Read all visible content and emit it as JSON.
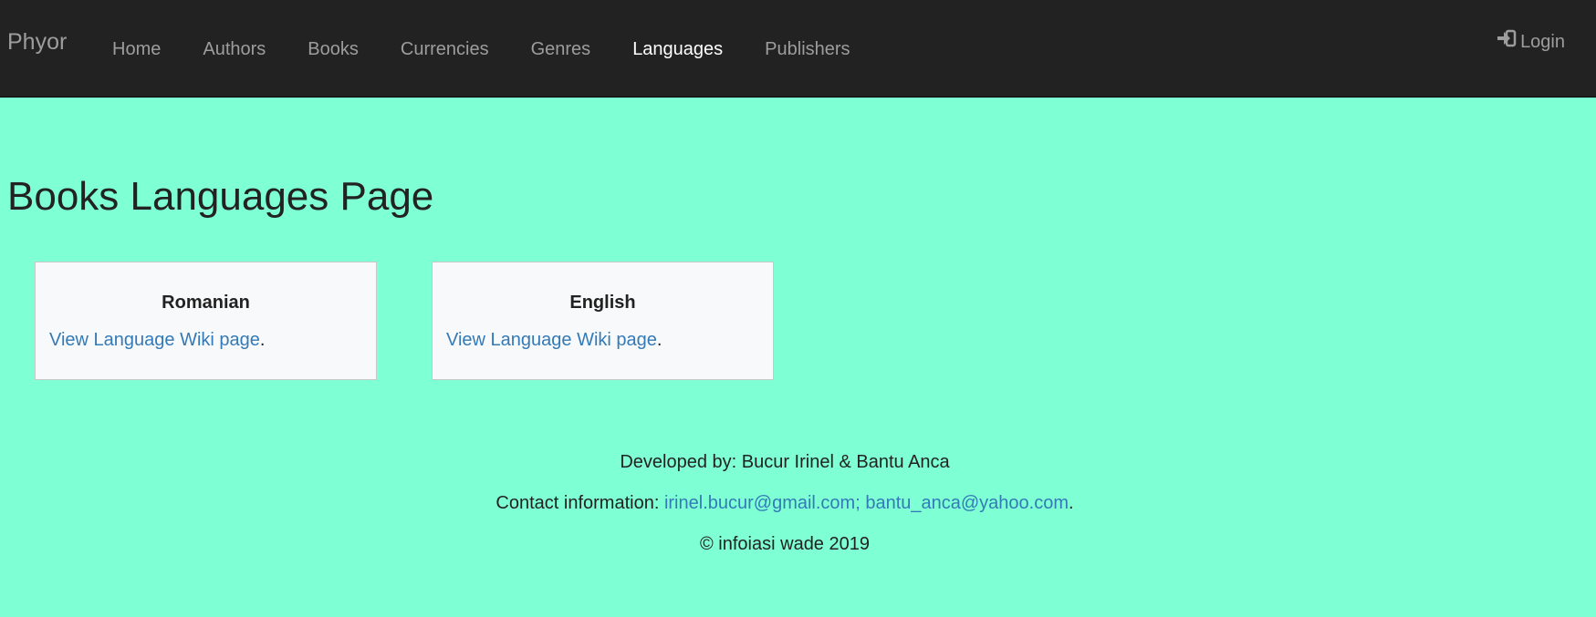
{
  "navbar": {
    "brand": "Phyor",
    "items": [
      {
        "label": "Home"
      },
      {
        "label": "Authors"
      },
      {
        "label": "Books"
      },
      {
        "label": "Currencies"
      },
      {
        "label": "Genres"
      },
      {
        "label": "Languages",
        "active": true
      },
      {
        "label": "Publishers"
      }
    ],
    "login_label": "Login",
    "login_icon": "sign-in-icon"
  },
  "main": {
    "title": "Books Languages Page",
    "cards": [
      {
        "title": "Romanian",
        "link_label": "View Language Wiki page",
        "suffix": "."
      },
      {
        "title": "English",
        "link_label": "View Language Wiki page",
        "suffix": "."
      }
    ]
  },
  "footer": {
    "developed_by": "Developed by: Bucur Irinel & Bantu Anca",
    "contact_prefix": "Contact information: ",
    "contact_emails": "irinel.bucur@gmail.com; bantu_anca@yahoo.com",
    "contact_suffix": ".",
    "copyright": "© infoiasi wade 2019"
  },
  "colors": {
    "navbar_bg": "#222222",
    "page_bg": "#7fffd4",
    "link": "#337ab7",
    "nav_text": "#9d9d9d",
    "nav_active": "#ffffff"
  }
}
